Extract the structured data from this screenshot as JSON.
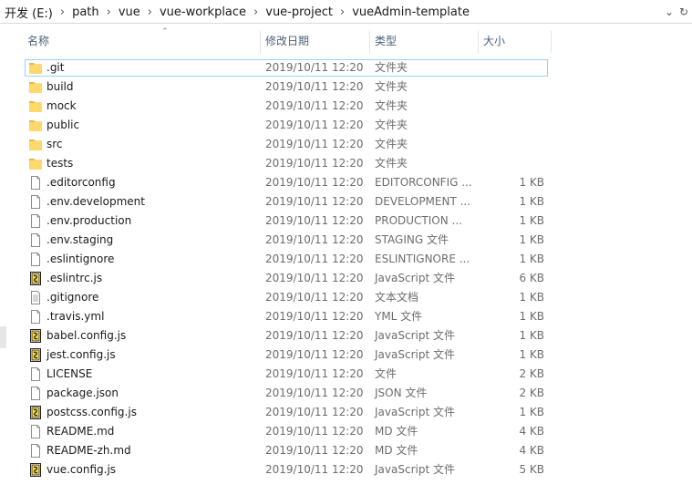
{
  "breadcrumb": [
    {
      "label": "开发 (E:)"
    },
    {
      "label": "path"
    },
    {
      "label": "vue"
    },
    {
      "label": "vue-workplace"
    },
    {
      "label": "vue-project"
    },
    {
      "label": "vueAdmin-template"
    }
  ],
  "address_icons": {
    "dropdown": "chevron-down-icon",
    "refresh": "refresh-icon"
  },
  "columns": {
    "name": "名称",
    "date": "修改日期",
    "type": "类型",
    "size": "大小"
  },
  "files": [
    {
      "name": ".git",
      "date": "2019/10/11 12:20",
      "type": "文件夹",
      "size": "",
      "icon": "folder",
      "selected": true
    },
    {
      "name": "build",
      "date": "2019/10/11 12:20",
      "type": "文件夹",
      "size": "",
      "icon": "folder"
    },
    {
      "name": "mock",
      "date": "2019/10/11 12:20",
      "type": "文件夹",
      "size": "",
      "icon": "folder"
    },
    {
      "name": "public",
      "date": "2019/10/11 12:20",
      "type": "文件夹",
      "size": "",
      "icon": "folder"
    },
    {
      "name": "src",
      "date": "2019/10/11 12:20",
      "type": "文件夹",
      "size": "",
      "icon": "folder"
    },
    {
      "name": "tests",
      "date": "2019/10/11 12:20",
      "type": "文件夹",
      "size": "",
      "icon": "folder"
    },
    {
      "name": ".editorconfig",
      "date": "2019/10/11 12:20",
      "type": "EDITORCONFIG ...",
      "size": "1 KB",
      "icon": "file"
    },
    {
      "name": ".env.development",
      "date": "2019/10/11 12:20",
      "type": "DEVELOPMENT ...",
      "size": "1 KB",
      "icon": "file"
    },
    {
      "name": ".env.production",
      "date": "2019/10/11 12:20",
      "type": "PRODUCTION ...",
      "size": "1 KB",
      "icon": "file"
    },
    {
      "name": ".env.staging",
      "date": "2019/10/11 12:20",
      "type": "STAGING 文件",
      "size": "1 KB",
      "icon": "file"
    },
    {
      "name": ".eslintignore",
      "date": "2019/10/11 12:20",
      "type": "ESLINTIGNORE ...",
      "size": "1 KB",
      "icon": "file"
    },
    {
      "name": ".eslintrc.js",
      "date": "2019/10/11 12:20",
      "type": "JavaScript 文件",
      "size": "6 KB",
      "icon": "js"
    },
    {
      "name": ".gitignore",
      "date": "2019/10/11 12:20",
      "type": "文本文档",
      "size": "1 KB",
      "icon": "text"
    },
    {
      "name": ".travis.yml",
      "date": "2019/10/11 12:20",
      "type": "YML 文件",
      "size": "1 KB",
      "icon": "file"
    },
    {
      "name": "babel.config.js",
      "date": "2019/10/11 12:20",
      "type": "JavaScript 文件",
      "size": "1 KB",
      "icon": "js"
    },
    {
      "name": "jest.config.js",
      "date": "2019/10/11 12:20",
      "type": "JavaScript 文件",
      "size": "1 KB",
      "icon": "js"
    },
    {
      "name": "LICENSE",
      "date": "2019/10/11 12:20",
      "type": "文件",
      "size": "2 KB",
      "icon": "file"
    },
    {
      "name": "package.json",
      "date": "2019/10/11 12:20",
      "type": "JSON 文件",
      "size": "2 KB",
      "icon": "file"
    },
    {
      "name": "postcss.config.js",
      "date": "2019/10/11 12:20",
      "type": "JavaScript 文件",
      "size": "1 KB",
      "icon": "js"
    },
    {
      "name": "README.md",
      "date": "2019/10/11 12:20",
      "type": "MD 文件",
      "size": "4 KB",
      "icon": "file"
    },
    {
      "name": "README-zh.md",
      "date": "2019/10/11 12:20",
      "type": "MD 文件",
      "size": "4 KB",
      "icon": "file"
    },
    {
      "name": "vue.config.js",
      "date": "2019/10/11 12:20",
      "type": "JavaScript 文件",
      "size": "5 KB",
      "icon": "js"
    }
  ],
  "colors": {
    "folder": "#ffd86b",
    "selection_border": "#99d1ff",
    "header_text": "#4c607a",
    "muted_text": "#6d6d6d"
  }
}
